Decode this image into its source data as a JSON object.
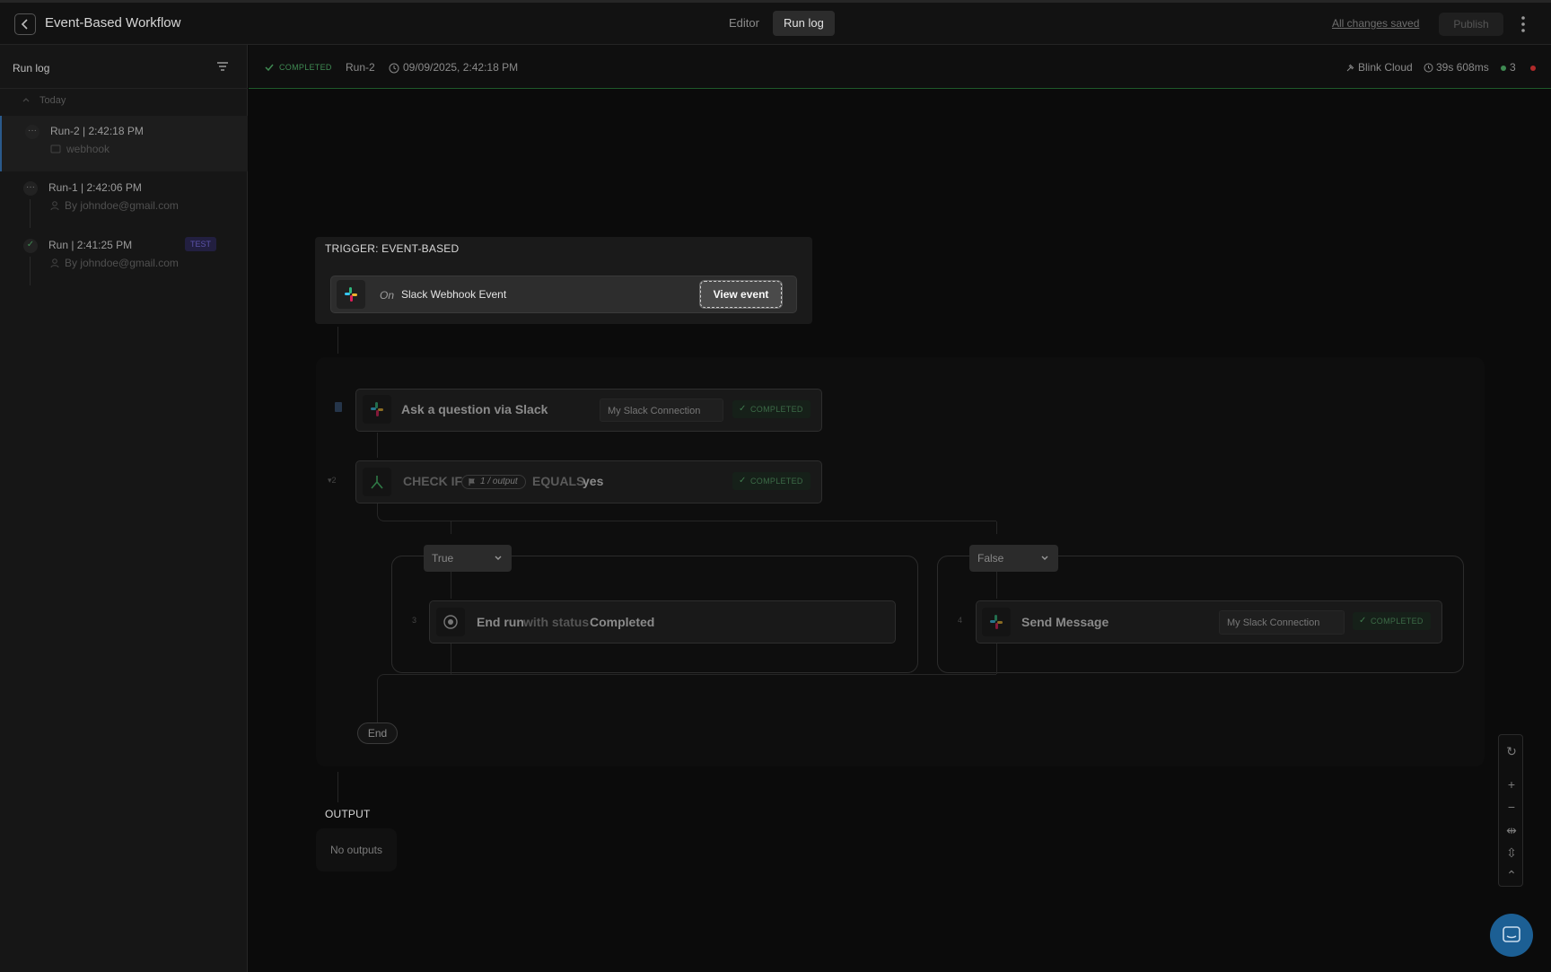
{
  "header": {
    "title": "Event-Based Workflow",
    "tabs": [
      {
        "label": "Editor"
      },
      {
        "label": "Run log",
        "active": true
      }
    ],
    "save_status": "All changes saved",
    "publish_label": "Publish"
  },
  "sidebar": {
    "title": "Run log",
    "group_label": "Today",
    "runs": [
      {
        "name": "Run-2  |  2:42:18 PM",
        "sub": "webhook",
        "status": "running",
        "selected": true
      },
      {
        "name": "Run-1  |  2:42:06 PM",
        "sub": "By johndoe@gmail.com",
        "status": "running"
      },
      {
        "name": "Run  |  2:41:25 PM",
        "sub": "By johndoe@gmail.com",
        "status": "completed",
        "badge": "TEST"
      }
    ]
  },
  "status_bar": {
    "status": "COMPLETED",
    "run_name": "Run-2",
    "datetime": "09/09/2025, 2:42:18 PM",
    "environment": "Blink Cloud",
    "duration": "39s 608ms",
    "success_count": "3"
  },
  "trigger": {
    "label": "TRIGGER: EVENT-BASED",
    "prefix": "On",
    "name": "Slack Webhook Event",
    "button": "View event"
  },
  "steps": {
    "step1": {
      "title": "Ask a question via Slack",
      "connection": "My Slack Connection",
      "status": "COMPLETED"
    },
    "step2": {
      "index": "2",
      "check": "CHECK IF",
      "var": "1 / output",
      "op": "EQUALS",
      "value": "yes",
      "status": "COMPLETED"
    },
    "true_branch": {
      "label": "True",
      "index": "3",
      "action": "End run",
      "with": "with status",
      "value": "Completed"
    },
    "false_branch": {
      "label": "False",
      "index": "4",
      "title": "Send Message",
      "connection": "My Slack Connection",
      "status": "COMPLETED"
    },
    "end_label": "End"
  },
  "output": {
    "label": "OUTPUT",
    "empty": "No outputs"
  },
  "colors": {
    "accent": "#1c5f94",
    "success": "#3f8a52",
    "error": "#b02a2a"
  }
}
